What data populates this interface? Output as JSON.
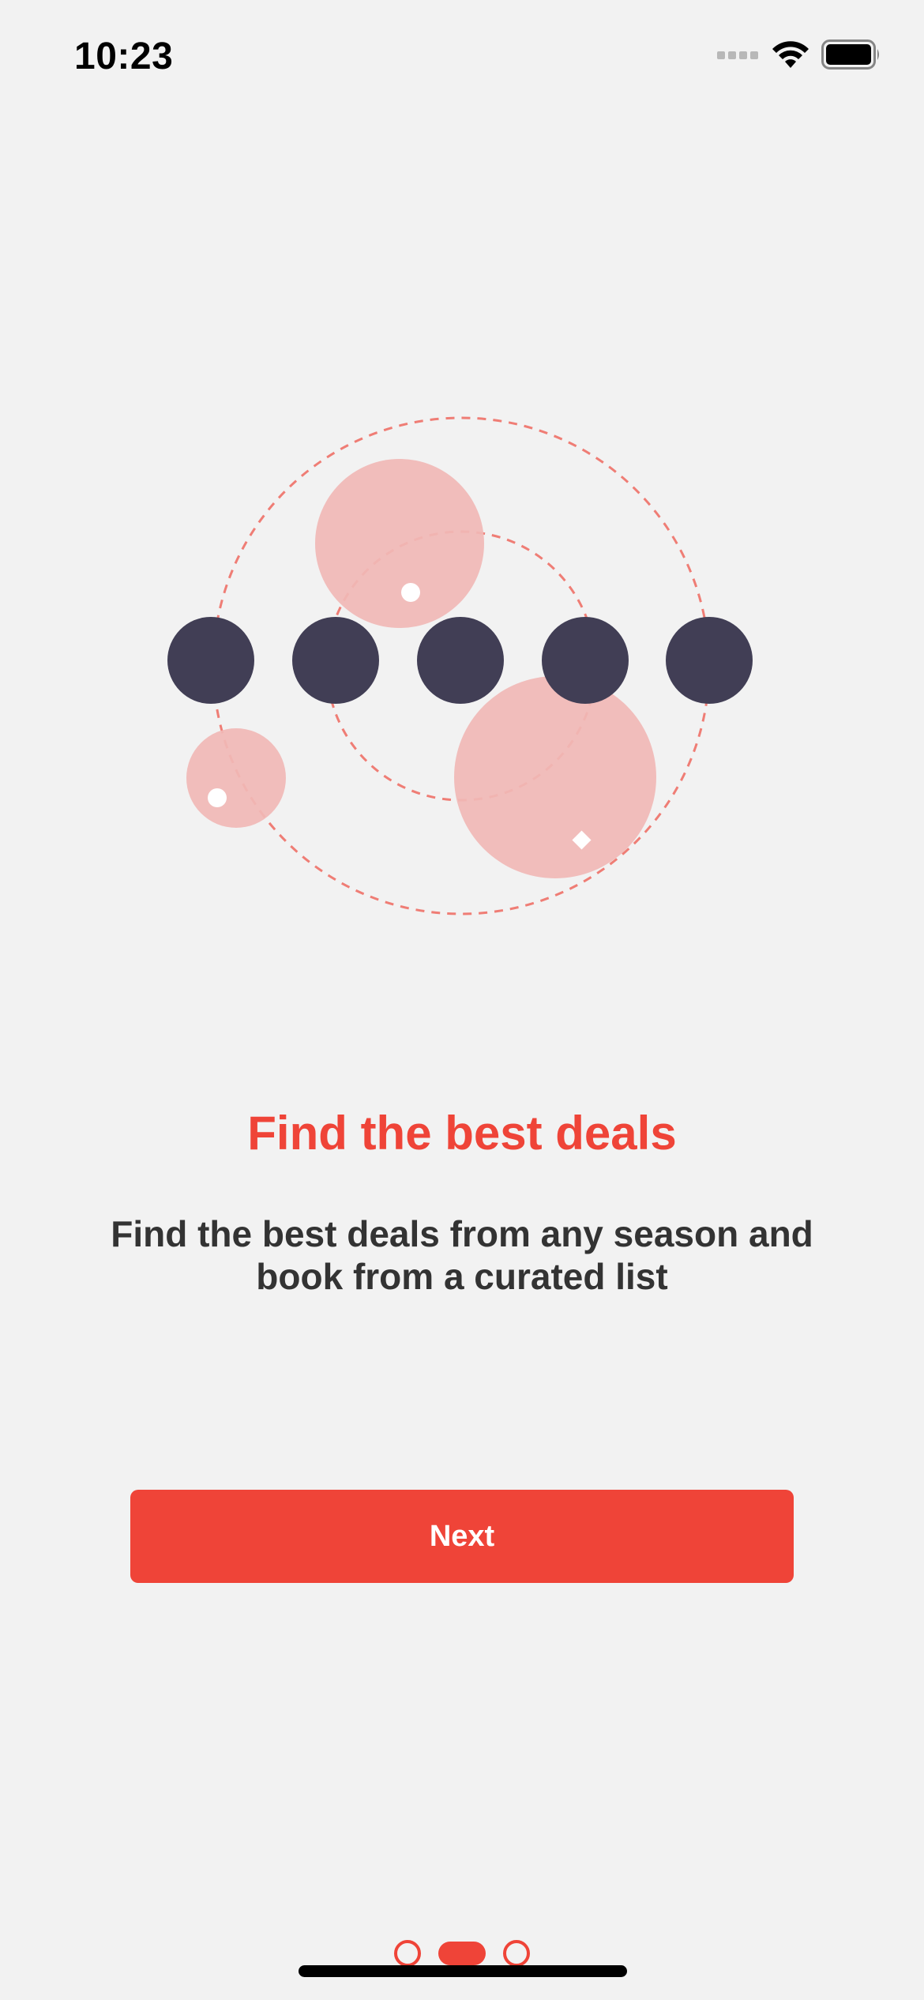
{
  "status_bar": {
    "time": "10:23",
    "icons": [
      "cellular-signal-icon",
      "wifi-icon",
      "battery-icon"
    ]
  },
  "illustration": {
    "name": "deals-orbit-illustration",
    "colors": {
      "dark_dot": "#413e55",
      "pink_bubble": "#f1b8b6",
      "dashed_orbit": "#ef7d75"
    }
  },
  "onboarding": {
    "title": "Find the best deals",
    "description": "Find the best deals from any season and book from a curated list",
    "next_label": "Next",
    "page_count": 3,
    "current_page": 2
  },
  "colors": {
    "accent": "#ef4438",
    "background": "#f2f2f2",
    "text": "#333333"
  }
}
